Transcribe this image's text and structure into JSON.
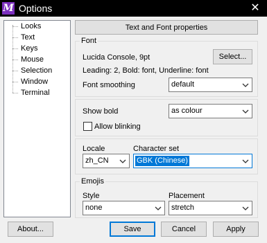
{
  "window": {
    "title": "Options",
    "close_symbol": "✕"
  },
  "tree": {
    "items": [
      "Looks",
      "Text",
      "Keys",
      "Mouse",
      "Selection",
      "Window",
      "Terminal"
    ]
  },
  "header": {
    "title": "Text and Font properties"
  },
  "font_group": {
    "label": "Font",
    "font_desc": "Lucida Console, 9pt",
    "select_label": "Select...",
    "details": "Leading: 2, Bold: font, Underline: font",
    "smoothing_label": "Font smoothing",
    "smoothing_value": "default"
  },
  "bold_group": {
    "show_bold_label": "Show bold",
    "show_bold_value": "as colour",
    "allow_blinking_label": "Allow blinking",
    "allow_blinking_checked": false
  },
  "locale_group": {
    "locale_label": "Locale",
    "locale_value": "zh_CN",
    "charset_label": "Character set",
    "charset_value": "GBK (Chinese)"
  },
  "emojis_group": {
    "label": "Emojis",
    "style_label": "Style",
    "style_value": "none",
    "placement_label": "Placement",
    "placement_value": "stretch"
  },
  "footer": {
    "about_label": "About...",
    "save_label": "Save",
    "cancel_label": "Cancel",
    "apply_label": "Apply"
  },
  "colors": {
    "accent": "#0078d7",
    "titlebar": "#000000",
    "app_icon": "#7b2fbe"
  },
  "icons": {
    "app": "mintty-icon",
    "close": "close-icon",
    "dropdown": "chevron-down-icon"
  }
}
